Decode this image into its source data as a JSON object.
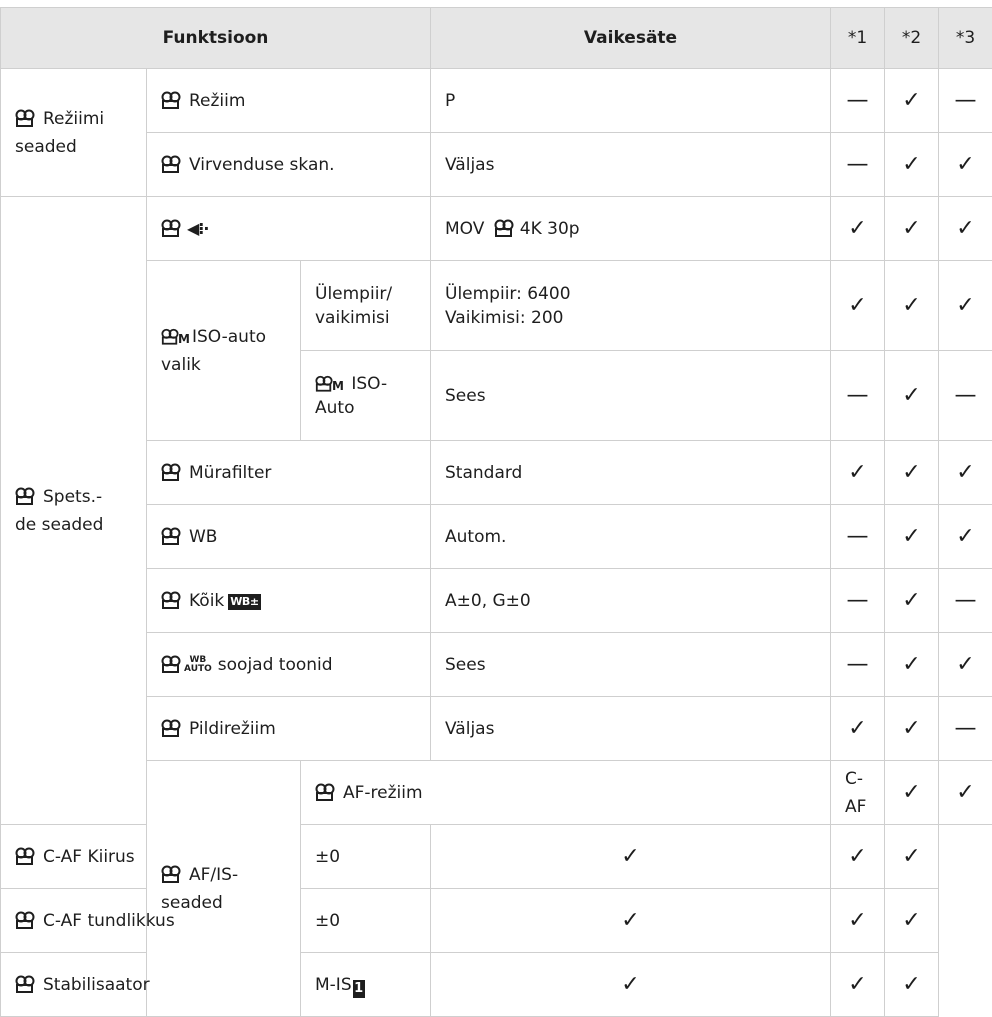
{
  "header": {
    "function": "Funktsioon",
    "default": "Vaikesäte",
    "c1": "*1",
    "c2": "*2",
    "c3": "*3"
  },
  "groups": {
    "g1_line1": "Režiimi",
    "g1_line2": "seaded",
    "g2_line1": "Spets.-",
    "g2_line2": "de seaded",
    "g3_line1": "AF/IS-",
    "g3_line2": "seaded"
  },
  "rows": [
    {
      "label": "Režiim",
      "value": "P",
      "marks": [
        "—",
        "✓",
        "—"
      ]
    },
    {
      "label": "Virvenduse skan.",
      "value": "Väljas",
      "marks": [
        "—",
        "✓",
        "✓"
      ]
    },
    {
      "label": "",
      "value": "MOV",
      "value_suffix": "4K 30p",
      "marks": [
        "✓",
        "✓",
        "✓"
      ]
    },
    {
      "label": "ISO-auto",
      "label2": "valik",
      "sub": "Ülempiir/",
      "sub2": "vaikimisi",
      "value": "Ülempiir: 6400",
      "value2": "Vaikimisi: 200",
      "marks": [
        "✓",
        "✓",
        "✓"
      ]
    },
    {
      "sub": "ISO-",
      "sub2": "Auto",
      "value": "Sees",
      "marks": [
        "—",
        "✓",
        "—"
      ]
    },
    {
      "label": "Mürafilter",
      "value": "Standard",
      "marks": [
        "✓",
        "✓",
        "✓"
      ]
    },
    {
      "label": "WB",
      "value": "Autom.",
      "marks": [
        "—",
        "✓",
        "✓"
      ]
    },
    {
      "label": "Kõik",
      "badge": "WB",
      "value": "A±0, G±0",
      "marks": [
        "—",
        "✓",
        "—"
      ]
    },
    {
      "label": "soojad toonid",
      "badge_top": "WB",
      "badge_bottom": "AUTO",
      "value": "Sees",
      "marks": [
        "—",
        "✓",
        "✓"
      ]
    },
    {
      "label": "Pildirežiim",
      "value": "Väljas",
      "marks": [
        "✓",
        "✓",
        "—"
      ]
    },
    {
      "label": "AF-režiim",
      "value": "C-AF",
      "marks": [
        "✓",
        "✓",
        "✓"
      ]
    },
    {
      "label": "C-AF Kiirus",
      "value": "±0",
      "marks": [
        "✓",
        "✓",
        "✓"
      ]
    },
    {
      "label": "C-AF tundlikkus",
      "value": "±0",
      "marks": [
        "✓",
        "✓",
        "✓"
      ]
    },
    {
      "label": "Stabilisaator",
      "value": "M-IS",
      "value_badge": "1",
      "marks": [
        "✓",
        "✓",
        "✓"
      ]
    }
  ],
  "icons": {
    "video": "movie-camera-icon",
    "movie_mode_m": "M",
    "record_quality": "image-quality-icon"
  }
}
